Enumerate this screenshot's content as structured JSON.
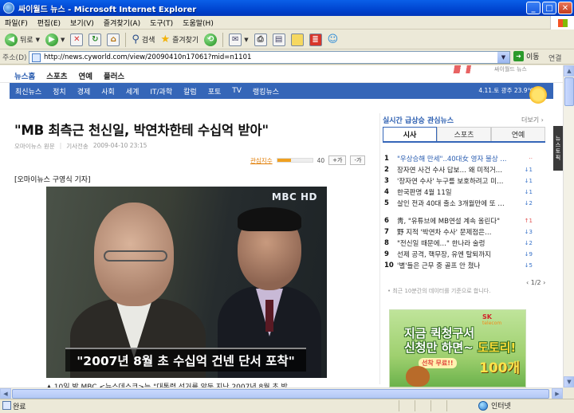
{
  "window": {
    "title": "싸이월드 뉴스 - Microsoft Internet Explorer",
    "buttons": {
      "minimize": "_",
      "maximize": "□",
      "close": "✕"
    }
  },
  "menu": [
    "파일(F)",
    "편집(E)",
    "보기(V)",
    "즐겨찾기(A)",
    "도구(T)",
    "도움말(H)"
  ],
  "toolbar": {
    "back_label": "뒤로",
    "search_label": "검색",
    "favorites_label": "즐겨찾기"
  },
  "address": {
    "label": "주소(D)",
    "url": "http://news.cyworld.com/view/20090410n17061?mid=n1101",
    "go_label": "이동",
    "links_label": "연결"
  },
  "site": {
    "nav": [
      "뉴스홈",
      "스포츠",
      "연예",
      "플러스"
    ],
    "top_right": "싸이월드 뉴스",
    "categories": [
      "최신뉴스",
      "정치",
      "경제",
      "사회",
      "세계",
      "IT/과학",
      "칼럼",
      "포토",
      "TV",
      "랭킹뉴스"
    ],
    "weather": "4.11.토 광주 23.9℃"
  },
  "article": {
    "title": "\"MB 최측근 천신일, 박연차한테 수십억 받아\"",
    "source": "오마이뉴스 원문",
    "sent_label": "기사전송",
    "date": "2009-04-10 23:15",
    "relevance_label": "관심지수",
    "relevance_value": "40",
    "relevance_fraction": 0.4,
    "font_up": "+가",
    "font_down": "-가",
    "reporter": "[오마이뉴스 구영식 기자]",
    "photo_logo": "MBC HD",
    "photo_caption": "\"2007년 8월 초 수십억 건넨 단서 포착\"",
    "body_start": "▲ 10일 밤 MBC <뉴스데스크>는 \"대통령 선거를 앞둔 지난 2007년 8월 초 박"
  },
  "sidebar": {
    "title": "실시간 급상승 관심뉴스",
    "more": "더보기 ›",
    "tabs": [
      "시사",
      "스포츠",
      "연예"
    ],
    "active_tab": "시사",
    "items": [
      {
        "num": "1",
        "text": "\"우상승해 만세\"..40대女 영자 불상 ...",
        "change": "··"
      },
      {
        "num": "2",
        "text": "장자연 사건 수사 답보… 왜 미적거…",
        "change": "↓1"
      },
      {
        "num": "3",
        "text": "'장자연 수사' 누구를 보호하려고 미…",
        "change": "↓1"
      },
      {
        "num": "4",
        "text": "한국판명 4월 11일",
        "change": "↓1"
      },
      {
        "num": "5",
        "text": "살인 전과 40대 출소 3개월만에 또 …",
        "change": "↓2"
      },
      {
        "num": "6",
        "text": "靑, \"유튜브에 MB연설 계속 올린다\"",
        "change": "↑1"
      },
      {
        "num": "7",
        "text": "野 지적 '박연차 수사' 문제점은…",
        "change": "↓3"
      },
      {
        "num": "8",
        "text": "\"전신일 때문에…\" 한나라 술렁",
        "change": "↓2"
      },
      {
        "num": "9",
        "text": "선제 공격, 핵무장, 유엔 탈퇴까지",
        "change": "↓9"
      },
      {
        "num": "10",
        "text": "'별'들은 근무 중 골프 안 쳤나",
        "change": "↓5"
      }
    ],
    "pager": "‹ 1/2 ›",
    "note": "• 최근 10분간의 데이터를 기준으로 합니다.",
    "side_tab": "뉴스토픽"
  },
  "ad": {
    "brand": "SK",
    "brand_sub": "telecom",
    "line1": "지금 퀵청구서",
    "line2_a": "신청만 하면~",
    "line2_b": "도토리!",
    "badge": "선착 무료!!",
    "count": "100개"
  },
  "status": {
    "text": "완료",
    "zone": "인터넷"
  }
}
